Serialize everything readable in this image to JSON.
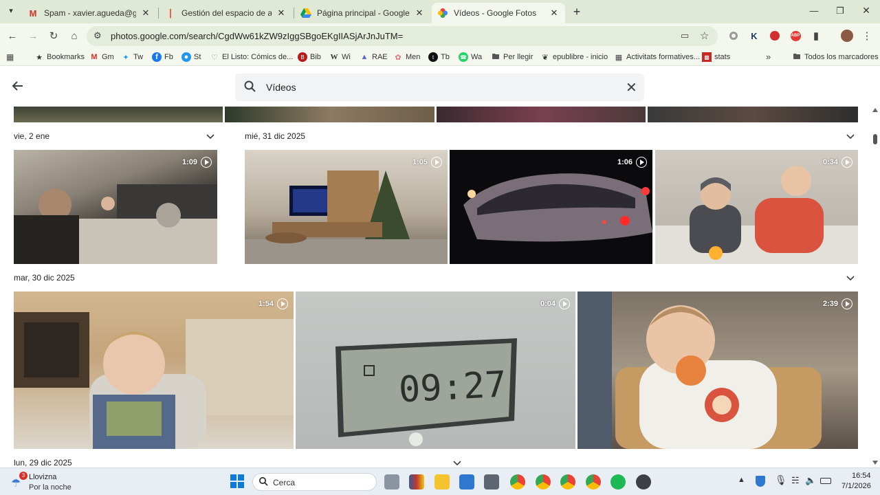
{
  "browser": {
    "tabs": [
      {
        "title": "Spam - xavier.agueda@gmail.c",
        "favicon": "gmail-icon",
        "active": false
      },
      {
        "title": "Gestión del espacio de almacer",
        "favicon": "google-one-icon",
        "active": false
      },
      {
        "title": "Página principal - Google Drive",
        "favicon": "drive-icon",
        "active": false
      },
      {
        "title": "Vídeos - Google Fotos",
        "favicon": "photos-icon",
        "active": true
      }
    ],
    "url": "photos.google.com/search/CgdWw61kZW9zIggSBgoEKgIIASjArJnJuTM=",
    "bookmarks": [
      {
        "label": "Bookmarks",
        "icon": "star-icon"
      },
      {
        "label": "Gm",
        "icon": "gmail-icon"
      },
      {
        "label": "Tw",
        "icon": "twitter-icon"
      },
      {
        "label": "Fb",
        "icon": "facebook-icon"
      },
      {
        "label": "St",
        "icon": "st-icon"
      },
      {
        "label": "El Listo: Cómics de...",
        "icon": "heart-icon"
      },
      {
        "label": "Bib",
        "icon": "bib-icon"
      },
      {
        "label": "Wi",
        "icon": "wikipedia-icon"
      },
      {
        "label": "RAE",
        "icon": "rae-icon"
      },
      {
        "label": "Men",
        "icon": "men-icon"
      },
      {
        "label": "Tb",
        "icon": "tb-icon"
      },
      {
        "label": "Wa",
        "icon": "whatsapp-icon"
      },
      {
        "label": "Per llegir",
        "icon": "folder-icon"
      },
      {
        "label": "epublibre - inicio",
        "icon": "epublibre-icon"
      },
      {
        "label": "Activitats formatives...",
        "icon": "building-icon"
      },
      {
        "label": "stats",
        "icon": "stats-icon"
      }
    ],
    "all_bookmarks_label": "Todos los marcadores"
  },
  "photos": {
    "search_query": "Vídeos",
    "groups": [
      {
        "date": "vie, 2 ene",
        "videos": [
          {
            "duration": "1:09"
          }
        ]
      },
      {
        "date": "mié, 31 dic 2025",
        "videos": [
          {
            "duration": "1:05"
          },
          {
            "duration": "1:06"
          },
          {
            "duration": "0:34"
          }
        ]
      },
      {
        "date": "mar, 30 dic 2025",
        "videos": [
          {
            "duration": "1:54"
          },
          {
            "duration": "0:04"
          },
          {
            "duration": "2:39"
          }
        ]
      },
      {
        "date": "lun, 29 dic 2025",
        "videos": []
      }
    ],
    "lcd_display": "09:27"
  },
  "taskbar": {
    "weather_badge": "3",
    "weather_title": "Llovizna",
    "weather_subtitle": "Por la noche",
    "search_label": "Cerca",
    "time": "16:54",
    "date": "7/1/2026"
  },
  "colors": {
    "tabstrip": "#dfe9d5",
    "toolbar": "#f3f7ee",
    "accent_blue": "#1a73e8"
  }
}
